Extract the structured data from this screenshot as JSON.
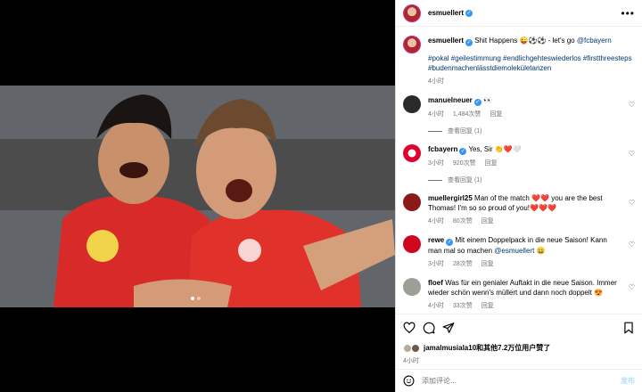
{
  "header": {
    "username": "esmuellert",
    "more": "•••"
  },
  "caption": {
    "username": "esmuellert",
    "text": "Shit Happens 😜⚽⚽ - let's go ",
    "mention": "@fcbayern",
    "hashtags": "#pokal #geilestimmung #endlichgehteswiederlos #firstthreesteps #budenmachenlässtdiemolekületanzen",
    "time": "4小时"
  },
  "comments": [
    {
      "user": "manuelneuer",
      "verified": true,
      "text": "👀",
      "time": "4小时",
      "likes": "1,484次赞",
      "reply": "回复",
      "replies": "查看回复 (1)"
    },
    {
      "user": "fcbayern",
      "verified": true,
      "text": "Yes, Sir 👏❤️🤍",
      "time": "3小时",
      "likes": "920次赞",
      "reply": "回复",
      "replies": "查看回复 (1)"
    },
    {
      "user": "muellergirl25",
      "verified": false,
      "text": "Man of the match ❤️❤️ you are the best Thomas! I'm so so proud of you!❤️❤️❤️",
      "time": "4小时",
      "likes": "80次赞",
      "reply": "回复"
    },
    {
      "user": "rewe",
      "verified": true,
      "text": "Mit einem Doppelpack in die neue Saison! Kann man mal so machen ",
      "mention": "@esmuellert",
      "emoji": " 😀",
      "time": "3小时",
      "likes": "28次赞",
      "reply": "回复"
    },
    {
      "user": "floef",
      "verified": false,
      "text": "Was für ein genialer Auftakt in die neue Saison. Immer wieder schön wenn's müllert und dann noch doppelt 😍",
      "time": "4小时",
      "likes": "33次赞",
      "reply": "回复"
    }
  ],
  "likes_line": "jamalmusiala10和其他7.2万位用户赞了",
  "post_time": "4小时",
  "add_comment": {
    "placeholder": "添加评论...",
    "post": "发布"
  }
}
